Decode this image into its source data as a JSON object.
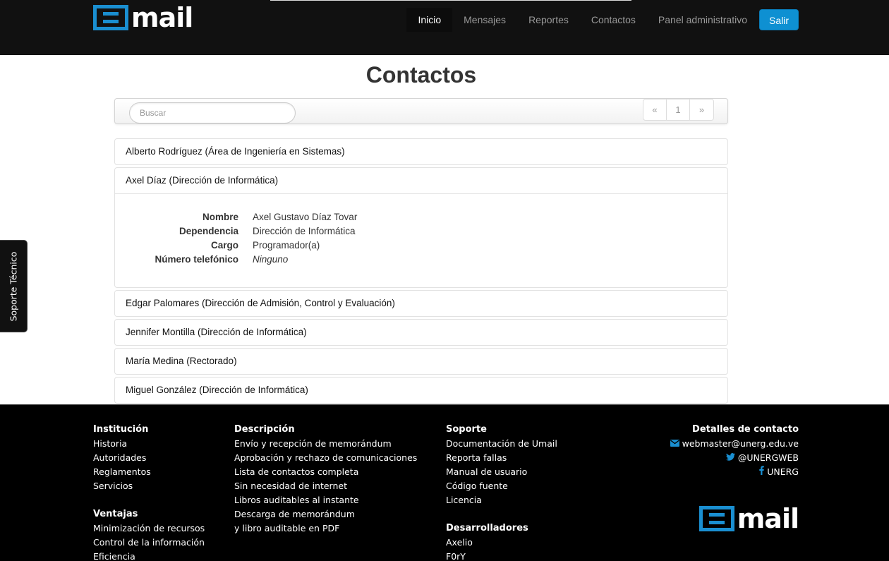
{
  "brand": {
    "logo_text": "mail",
    "accent_color": "#1a8fd1"
  },
  "nav": {
    "items": [
      {
        "label": "Inicio",
        "active": true
      },
      {
        "label": "Mensajes",
        "active": false
      },
      {
        "label": "Reportes",
        "active": false
      },
      {
        "label": "Contactos",
        "active": false
      },
      {
        "label": "Panel administrativo",
        "active": false
      }
    ],
    "logout_label": "Salir"
  },
  "page": {
    "title": "Contactos"
  },
  "toolbar": {
    "search_placeholder": "Buscar",
    "pager": {
      "prev": "«",
      "current": "1",
      "next": "»"
    }
  },
  "contacts": [
    {
      "label": "Alberto Rodríguez (Área de Ingeniería en Sistemas)"
    },
    {
      "label": "Axel Díaz (Dirección de Informática)",
      "expanded": true
    },
    {
      "label": "Edgar Palomares (Dirección de Admisión, Control y Evaluación)"
    },
    {
      "label": "Jennifer Montilla (Dirección de Informática)"
    },
    {
      "label": "María Medina (Rectorado)"
    },
    {
      "label": "Miguel González (Dirección de Informática)"
    }
  ],
  "contact_detail": {
    "nombre_label": "Nombre",
    "nombre": "Axel Gustavo Díaz Tovar",
    "dependencia_label": "Dependencia",
    "dependencia": "Dirección de Informática",
    "cargo_label": "Cargo",
    "cargo": "Programador(a)",
    "telefono_label": "Número telefónico",
    "telefono": "Ninguno"
  },
  "side_tab": {
    "label": "Soporte Técnico"
  },
  "footer": {
    "institucion": {
      "title": "Institución",
      "links": [
        "Historia",
        "Autoridades",
        "Reglamentos",
        "Servicios"
      ]
    },
    "ventajas": {
      "title": "Ventajas",
      "links": [
        "Minimización de recursos",
        "Control de la información",
        "Eficiencia"
      ]
    },
    "descripcion": {
      "title": "Descripción",
      "links": [
        "Envío y recepción de memorándum",
        "Aprobación y rechazo de comunicaciones",
        "Lista de contactos completa",
        "Sin necesidad de internet",
        "Libros auditables al instante",
        "Descarga de memorándum",
        "y libro auditable en PDF"
      ]
    },
    "soporte": {
      "title": "Soporte",
      "links": [
        "Documentación de Umail",
        "Reporta fallas",
        "Manual de usuario",
        "Código fuente",
        "Licencia"
      ]
    },
    "desarrolladores": {
      "title": "Desarrolladores",
      "links": [
        "Axelio",
        "F0rY"
      ]
    },
    "contacto": {
      "title": "Detalles de contacto",
      "email": "webmaster@unerg.edu.ve",
      "twitter": "@UNERGWEB",
      "facebook": "UNERG",
      "icons": [
        "envelope-icon",
        "twitter-icon",
        "facebook-icon"
      ]
    }
  }
}
